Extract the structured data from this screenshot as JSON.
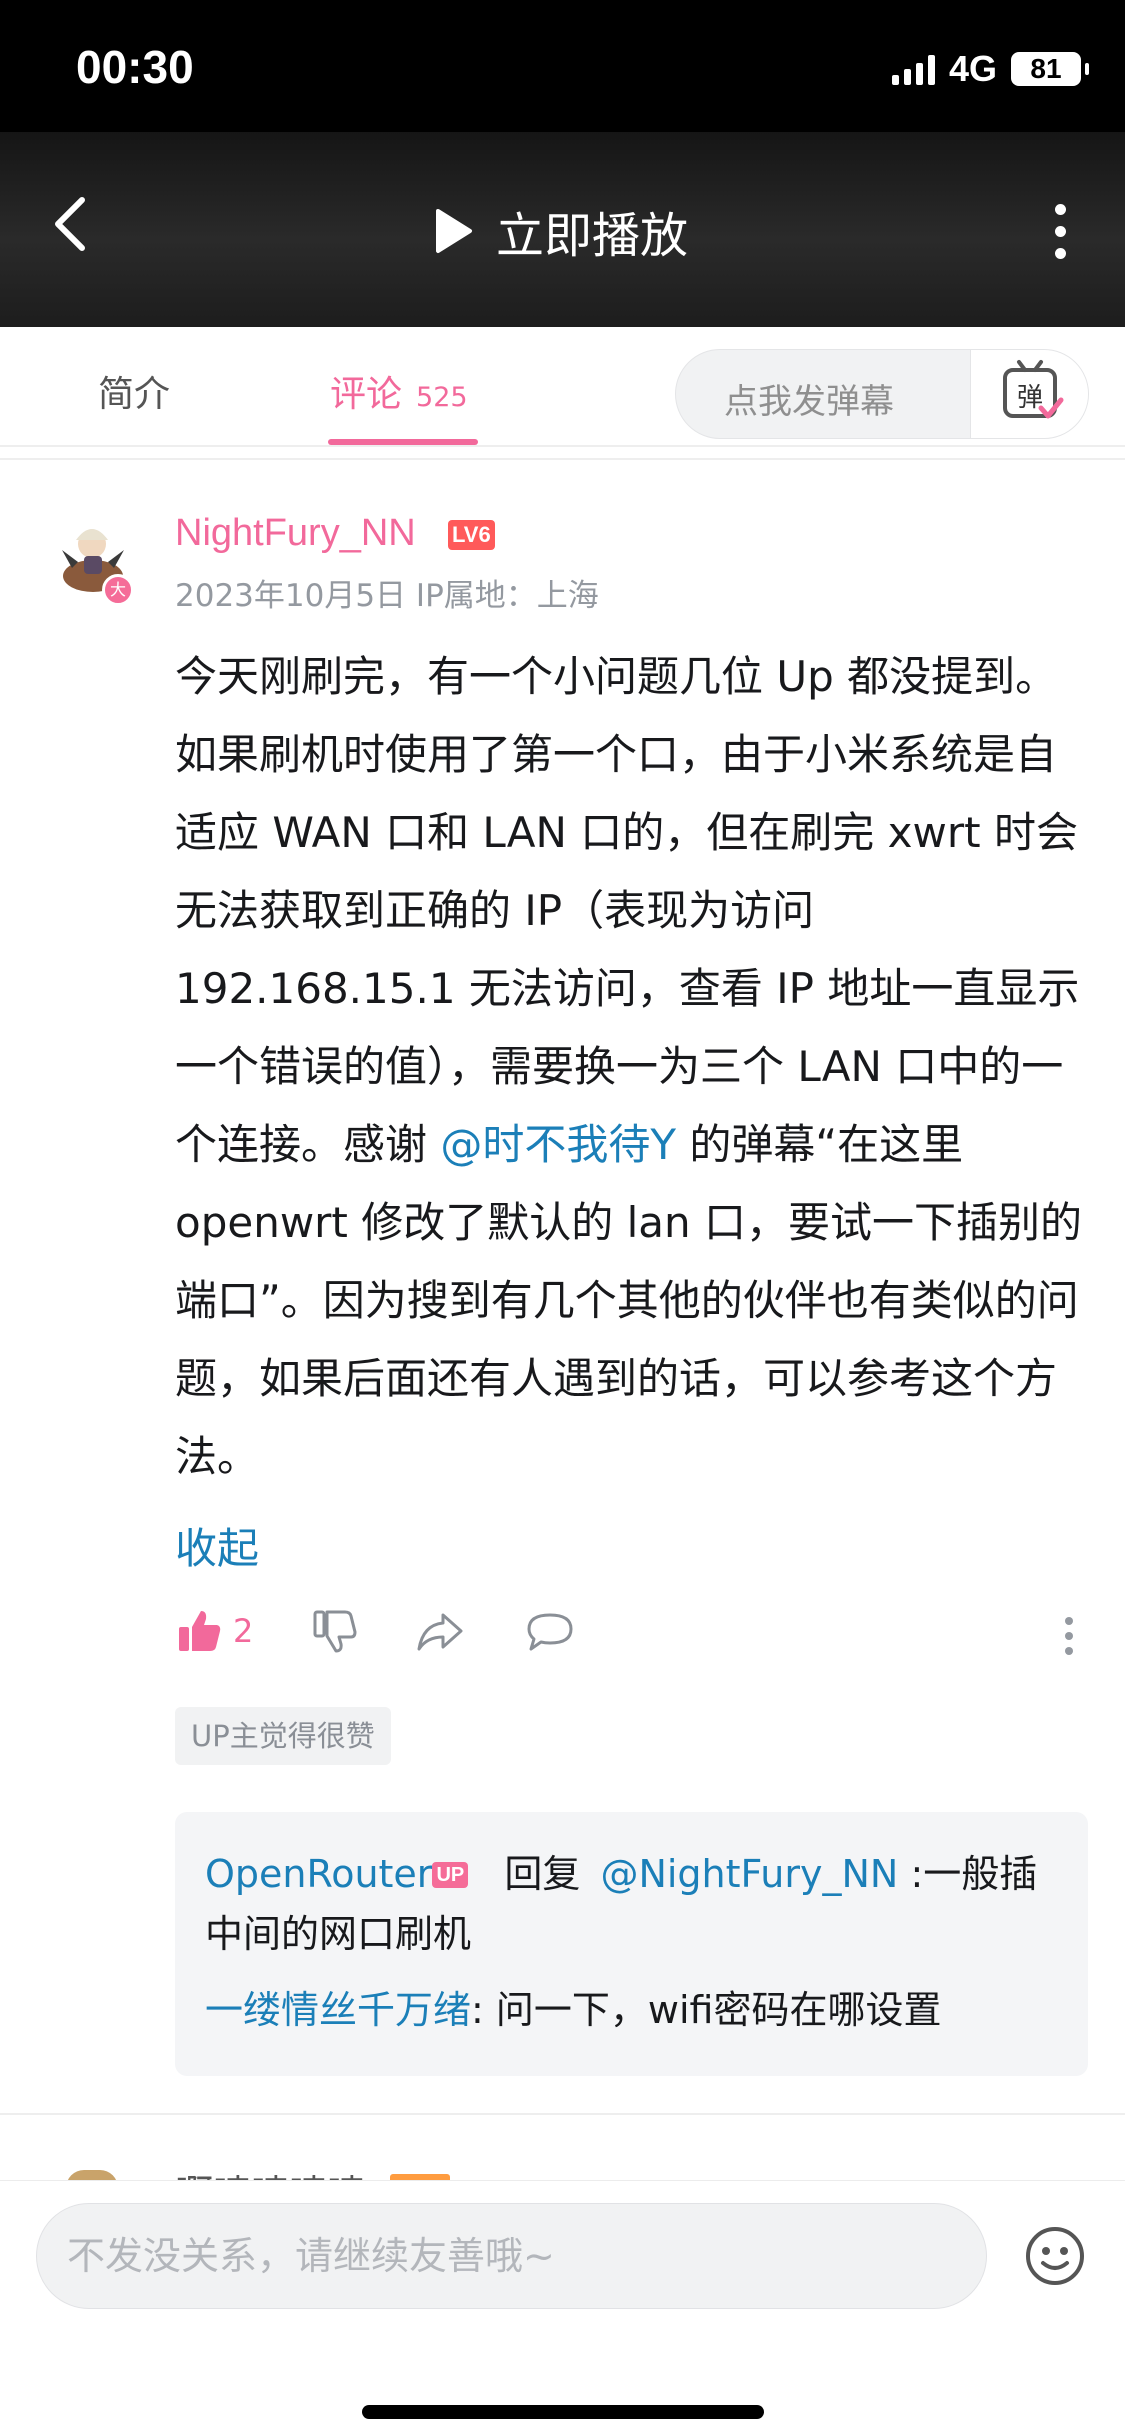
{
  "status_bar": {
    "time": "00:30",
    "network": "4G",
    "battery": "81"
  },
  "video_header": {
    "play_label": "立即播放",
    "icons": [
      "back-arrow-icon",
      "play-icon",
      "more-vertical-icon"
    ]
  },
  "tabs": {
    "intro_label": "简介",
    "comments_label": "评论",
    "comments_count": "525",
    "danmaku_placeholder": "点我发弹幕",
    "danmaku_icon_text": "弹",
    "accent_color": "#f2699b"
  },
  "comment": {
    "username": "NightFury_NN",
    "level": "LV6",
    "avatar_badge": "大",
    "date": "2023年10月5日",
    "ip_location": "IP属地：上海",
    "content_before_mention": "今天刚刷完，有一个小问题几位 Up 都没提到。如果刷机时使用了第一个口，由于小米系统是自适应 WAN 口和 LAN 口的，但在刷完 xwrt 时会无法获取到正确的 IP（表现为访问 192.168.15.1 无法访问，查看 IP 地址一直显示一个错误的值），需要换一为三个 LAN 口中的一个连接。感谢 ",
    "mention": "@时不我待Y",
    "content_after_mention": " 的弹幕“在这里 openwrt 修改了默认的 lan 口，要试一下插别的端口”。因为搜到有几个其他的伙伴也有类似的问题，如果后面还有人遇到的话，可以参考这个方法。",
    "collapse_label": "收起",
    "like_count": "2",
    "up_like_tag": "UP主觉得很赞",
    "action_icons": [
      "thumbs-up-icon",
      "thumbs-down-icon",
      "share-icon",
      "reply-icon",
      "more-icon"
    ]
  },
  "replies": [
    {
      "author": "OpenRouter",
      "author_tag": "UP",
      "reply_word": "回复",
      "target": "@NightFury_NN",
      "text": ":一般插中间的网口刷机"
    },
    {
      "author": "一缕情丝千万绪",
      "text": ": 问一下，wifi密码在哪设置"
    }
  ],
  "next_comment_peek": {
    "username": "啊啧啧啧啧"
  },
  "bottom_input": {
    "placeholder": "不发没关系，请继续友善哦~",
    "emoji_icon": "emoji-icon"
  }
}
